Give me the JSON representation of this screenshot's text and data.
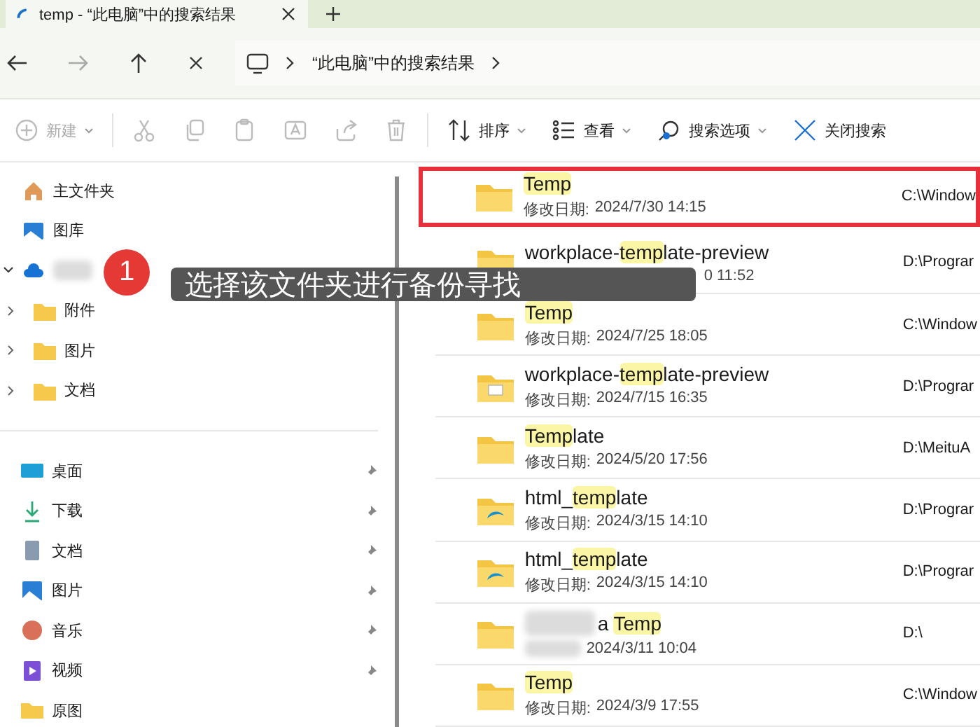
{
  "tabs": [
    {
      "title": "temp - “此电脑”中的搜索结果",
      "selected": true
    }
  ],
  "address": {
    "segments": [
      "“此电脑”中的搜索结果"
    ]
  },
  "toolbar": [
    {
      "kind": "new",
      "label": "新建",
      "disabled": true,
      "dropdown": true
    },
    {
      "kind": "cut",
      "disabled": true
    },
    {
      "kind": "copy",
      "disabled": true
    },
    {
      "kind": "paste",
      "disabled": true
    },
    {
      "kind": "rename",
      "disabled": true
    },
    {
      "kind": "share",
      "disabled": true
    },
    {
      "kind": "delete",
      "disabled": true
    },
    {
      "kind": "sort",
      "label": "排序",
      "disabled": false,
      "dropdown": true
    },
    {
      "kind": "view",
      "label": "查看",
      "disabled": false,
      "dropdown": true
    },
    {
      "kind": "search-options",
      "label": "搜索选项",
      "disabled": false,
      "dropdown": true
    },
    {
      "kind": "close-search",
      "label": "关闭搜索",
      "disabled": false
    }
  ],
  "sidebar": {
    "top": [
      {
        "kind": "home",
        "label": "主文件夹"
      },
      {
        "kind": "gallery",
        "label": "图库"
      },
      {
        "kind": "cloud",
        "blurred": true,
        "expanded": true,
        "children": [
          {
            "kind": "folder",
            "label": "附件",
            "expanded": false
          },
          {
            "kind": "folder",
            "label": "图片",
            "expanded": false
          },
          {
            "kind": "folder",
            "label": "文档",
            "expanded": false
          }
        ]
      }
    ],
    "pinned": [
      {
        "kind": "desktop",
        "label": "桌面",
        "pinned": true
      },
      {
        "kind": "download",
        "label": "下载",
        "pinned": true
      },
      {
        "kind": "document",
        "label": "文档",
        "pinned": true
      },
      {
        "kind": "picture",
        "label": "图片",
        "pinned": true
      },
      {
        "kind": "music",
        "label": "音乐",
        "pinned": true
      },
      {
        "kind": "video",
        "label": "视频",
        "pinned": true
      },
      {
        "kind": "folder",
        "label": "原图",
        "pinned": false
      }
    ]
  },
  "callout": {
    "badge": "1",
    "text": "选择该文件夹进行备份寻找"
  },
  "results": [
    {
      "kind": "folder",
      "match": "Temp",
      "date_label": "修改日期:",
      "date": "2024/7/30 14:15",
      "location": "C:\\Window",
      "marked": true
    },
    {
      "kind": "folder",
      "before": "workplace-",
      "match": "temp",
      "after": "late-preview",
      "date": "0 11:52",
      "location": "D:\\Prograr",
      "marked": false,
      "covered": true
    },
    {
      "kind": "folder",
      "match": "Temp",
      "date_label": "修改日期:",
      "date": "2024/7/25 18:05",
      "location": "C:\\Window",
      "marked": false
    },
    {
      "kind": "folder-image",
      "before": "workplace-",
      "match": "temp",
      "after": "late-preview",
      "date_label": "修改日期:",
      "date": "2024/7/15 16:35",
      "location": "D:\\Prograr",
      "marked": false
    },
    {
      "kind": "folder",
      "match": "Temp",
      "after": "late",
      "date_label": "修改日期:",
      "date": "2024/5/20 17:56",
      "location": "D:\\MeituA",
      "marked": false
    },
    {
      "kind": "folder-web",
      "before": "html_",
      "match": "temp",
      "after": "late",
      "date_label": "修改日期:",
      "date": "2024/3/15 14:10",
      "location": "D:\\Prograr",
      "marked": false
    },
    {
      "kind": "folder-web",
      "before": "html_",
      "match": "temp",
      "after": "late",
      "date_label": "修改日期:",
      "date": "2024/3/15 14:10",
      "location": "D:\\Prograr",
      "marked": false
    },
    {
      "kind": "folder",
      "before": "a ",
      "match": "Temp",
      "date": "2024/3/11 10:04",
      "location": "D:\\",
      "marked": false,
      "blurred": true
    },
    {
      "kind": "folder",
      "match": "Temp",
      "date_label": "修改日期:",
      "date": "2024/3/9 17:55",
      "location": "C:\\Window",
      "marked": false
    }
  ]
}
